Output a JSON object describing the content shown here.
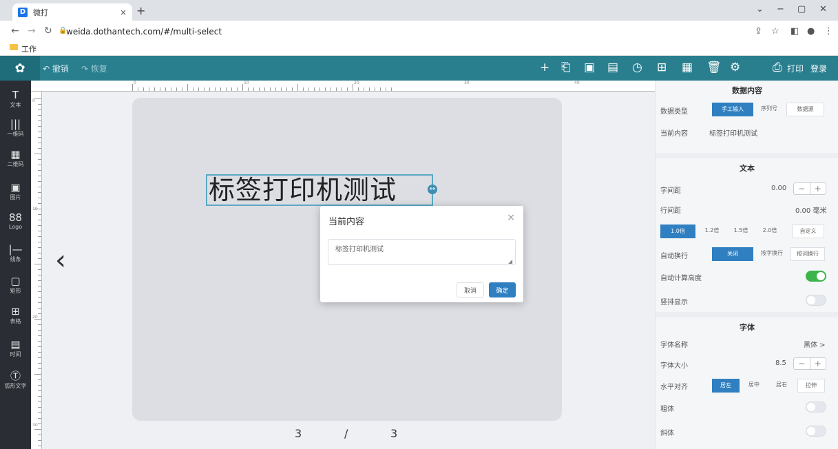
{
  "browser": {
    "tab_title": "微打",
    "tab_close": "×",
    "new_tab": "+",
    "url": "weida.dothantech.com/#/multi-select",
    "bookmark": "工作",
    "win_min": "−",
    "win_max": "▢",
    "win_close": "✕",
    "dropdown": "⌄"
  },
  "toolbar": {
    "undo_label": "撤销",
    "redo_label": "恢复",
    "print_label": "打印",
    "login_label": "登录"
  },
  "sidebar": {
    "items": [
      {
        "icon": "T",
        "label": "文本"
      },
      {
        "icon": "|||",
        "label": "一维码"
      },
      {
        "icon": "▦",
        "label": "二维码"
      },
      {
        "icon": "▣",
        "label": "图片"
      },
      {
        "icon": "88",
        "label": "Logo"
      },
      {
        "icon": "|—",
        "label": "线条"
      },
      {
        "icon": "▢",
        "label": "矩形"
      },
      {
        "icon": "⊞",
        "label": "表格"
      },
      {
        "icon": "▤",
        "label": "时间"
      },
      {
        "icon": "Ⓣ",
        "label": "弧形文字"
      }
    ]
  },
  "canvas": {
    "label_text": "标签打印机测试",
    "prev_arrow": "‹",
    "page_current": "3",
    "page_sep": "/",
    "page_total": "3",
    "ruler_top_numbers": [
      "0",
      "10",
      "20",
      "30",
      "40"
    ],
    "ruler_left_numbers": [
      "0",
      "10",
      "20",
      "30"
    ]
  },
  "dialog": {
    "title": "当前内容",
    "close": "×",
    "textarea_value": "标签打印机测试",
    "cancel_label": "取消",
    "ok_label": "确定"
  },
  "panel": {
    "data_section_title": "数据内容",
    "data_type_label": "数据类型",
    "data_type_options": [
      "手工输入",
      "序列号",
      "数据源"
    ],
    "current_content_label": "当前内容",
    "current_content_value": "标签打印机测试",
    "text_section_title": "文本",
    "char_spacing_label": "字间距",
    "char_spacing_value": "0.00",
    "line_spacing_label": "行间距",
    "line_spacing_value": "0.00 毫米",
    "line_spacing_options": [
      "1.0倍",
      "1.2倍",
      "1.5倍",
      "2.0倍",
      "自定义"
    ],
    "auto_wrap_label": "自动换行",
    "auto_wrap_options": [
      "关闭",
      "按字换行",
      "按词换行"
    ],
    "auto_height_label": "自动计算高度",
    "auto_height_on": true,
    "vertical_label": "竖排显示",
    "vertical_on": false,
    "font_section_title": "字体",
    "font_name_label": "字体名称",
    "font_name_value": "黑体 >",
    "font_size_label": "字体大小",
    "font_size_value": "8.5",
    "halign_label": "水平对齐",
    "halign_options": [
      "居左",
      "居中",
      "居右",
      "拉伸"
    ],
    "bold_label": "粗体",
    "bold_on": false,
    "italic_label": "斜体",
    "italic_on": false,
    "stepper_minus": "−",
    "stepper_plus": "+"
  },
  "colors": {
    "toolbar": "#2a7f8f",
    "sidebar": "#2a2d33",
    "accent": "#2f7fc1",
    "toggle_on": "#3cb44b"
  }
}
